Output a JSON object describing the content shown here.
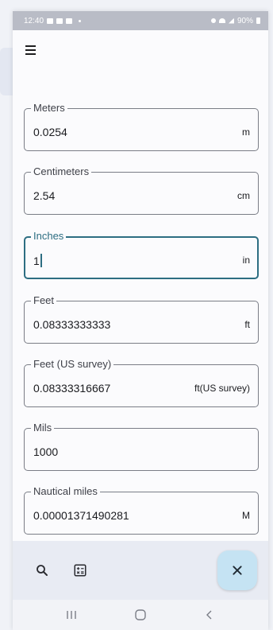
{
  "status_bar": {
    "time": "12:40",
    "battery": "90%"
  },
  "fields": [
    {
      "label": "Meters",
      "value": "0.0254",
      "unit": "m"
    },
    {
      "label": "Centimeters",
      "value": "2.54",
      "unit": "cm"
    },
    {
      "label": "Inches",
      "value": "1",
      "unit": "in"
    },
    {
      "label": "Feet",
      "value": "0.08333333333",
      "unit": "ft"
    },
    {
      "label": "Feet (US survey)",
      "value": "0.08333316667",
      "unit": "ft(US survey)"
    },
    {
      "label": "Mils",
      "value": "1000",
      "unit": ""
    },
    {
      "label": "Nautical miles",
      "value": "0.00001371490281",
      "unit": "M"
    }
  ],
  "focused_field": "Inches",
  "icons": {
    "menu": "hamburger-menu-icon",
    "search": "search-icon",
    "calculator": "calculator-icon",
    "close": "close-icon",
    "nav_recent": "recent-apps-icon",
    "nav_home": "home-icon",
    "nav_back": "back-icon"
  },
  "colors": {
    "focus_accent": "#2d6e82",
    "fab_background": "#c5e3f3",
    "bottom_bar": "#e8ebf3",
    "status_bar": "#b9bcc6"
  }
}
